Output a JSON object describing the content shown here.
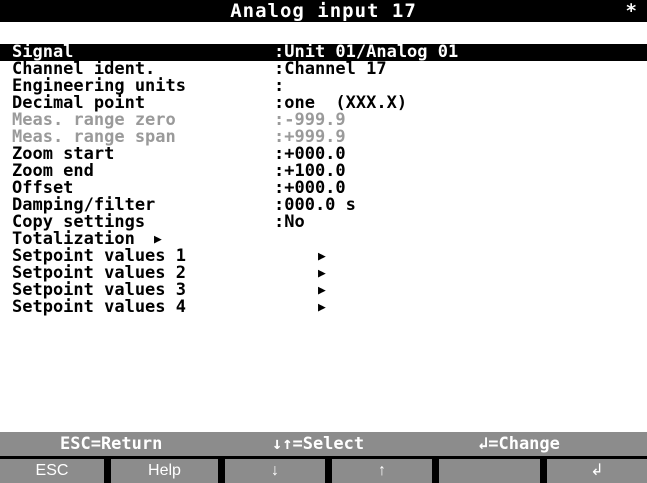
{
  "window": {
    "title": "Analog input 17",
    "marker": "*"
  },
  "menu": {
    "items": [
      {
        "label": "Signal",
        "value": ":Unit 01/Analog 01",
        "state": "selected"
      },
      {
        "label": "Channel ident.",
        "value": ":Channel 17",
        "state": "normal"
      },
      {
        "label": "Engineering units",
        "value": ":",
        "state": "normal"
      },
      {
        "label": "Decimal point",
        "value": ":one  (XXX.X)",
        "state": "normal"
      },
      {
        "label": "Meas. range zero",
        "value": ":-999.9",
        "state": "disabled"
      },
      {
        "label": "Meas. range span",
        "value": ":+999.9",
        "state": "disabled"
      },
      {
        "label": "Zoom start",
        "value": ":+000.0",
        "state": "normal"
      },
      {
        "label": "Zoom end",
        "value": ":+100.0",
        "state": "normal"
      },
      {
        "label": "Offset",
        "value": ":+000.0",
        "state": "normal"
      },
      {
        "label": "Damping/filter",
        "value": ":000.0 s",
        "state": "normal"
      },
      {
        "label": "Copy settings",
        "value": ":No",
        "state": "normal"
      },
      {
        "label": "Totalization",
        "arrow": "▶",
        "state": "normal"
      },
      {
        "label": "Setpoint values 1",
        "arrow": "▶",
        "state": "normal"
      },
      {
        "label": "Setpoint values 2",
        "arrow": "▶",
        "state": "normal"
      },
      {
        "label": "Setpoint values 3",
        "arrow": "▶",
        "state": "normal"
      },
      {
        "label": "Setpoint values 4",
        "arrow": "▶",
        "state": "normal"
      }
    ]
  },
  "status_bar": {
    "esc_hint": "ESC=Return",
    "select_hint": "↓↑=Select",
    "change_hint": "↲=Change"
  },
  "softkeys": {
    "esc": "ESC",
    "help": "Help",
    "down": "↓",
    "up": "↑",
    "blank": "",
    "enter": "↲"
  },
  "colors": {
    "background": "#ffffff",
    "text": "#000000",
    "selection": "#000000",
    "disabled": "#9a9a9a",
    "bar": "#8c8c8c"
  }
}
